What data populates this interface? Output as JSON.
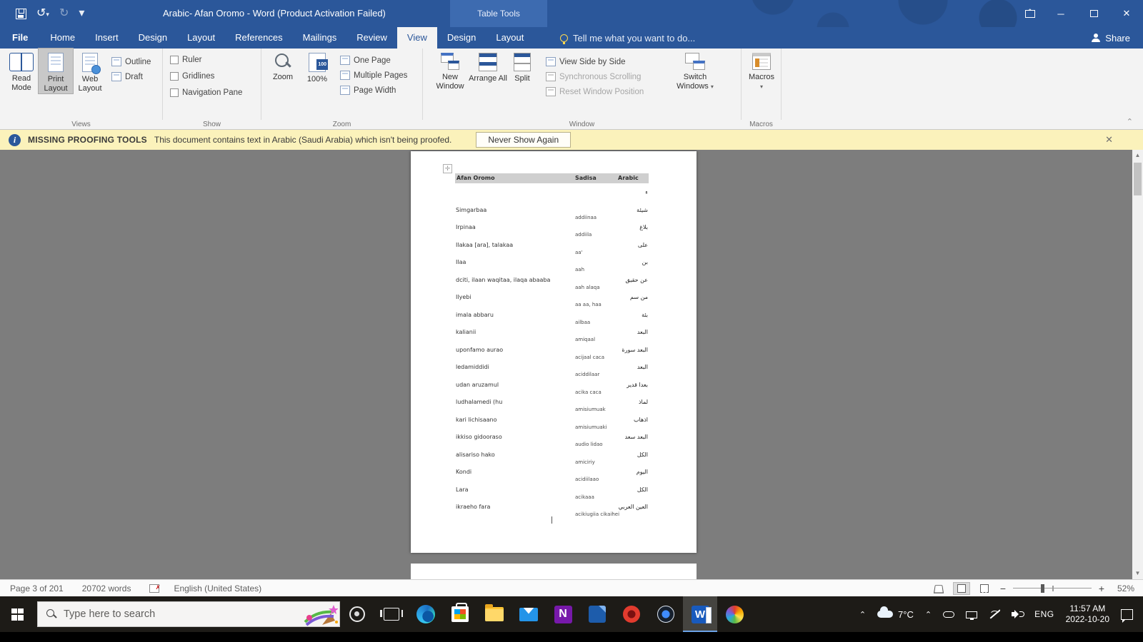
{
  "colors": {
    "accent": "#2b579a",
    "warning_bg": "#fbf2bb",
    "doc_bg": "#7d7d7d",
    "taskbar_bg": "#1d1b17"
  },
  "titlebar": {
    "title": "Arabic- Afan Oromo - Word (Product Activation Failed)",
    "contextual_group": "Table Tools"
  },
  "tabs": [
    {
      "label": "File",
      "type": "file"
    },
    {
      "label": "Home"
    },
    {
      "label": "Insert"
    },
    {
      "label": "Design"
    },
    {
      "label": "Layout"
    },
    {
      "label": "References"
    },
    {
      "label": "Mailings"
    },
    {
      "label": "Review"
    },
    {
      "label": "View",
      "active": true
    },
    {
      "label": "Design"
    },
    {
      "label": "Layout"
    }
  ],
  "tell_me": "Tell me what you want to do...",
  "share_label": "Share",
  "ribbon": {
    "views": {
      "group_label": "Views",
      "read_mode": "Read Mode",
      "print_layout": "Print Layout",
      "web_layout": "Web Layout",
      "outline": "Outline",
      "draft": "Draft"
    },
    "show": {
      "group_label": "Show",
      "ruler": "Ruler",
      "gridlines": "Gridlines",
      "nav_pane": "Navigation Pane"
    },
    "zoom": {
      "group_label": "Zoom",
      "zoom": "Zoom",
      "hundred": "100%",
      "one_page": "One Page",
      "multiple_pages": "Multiple Pages",
      "page_width": "Page Width"
    },
    "window": {
      "group_label": "Window",
      "new_window": "New Window",
      "arrange_all": "Arrange All",
      "split": "Split",
      "side_by_side": "View Side by Side",
      "sync_scrolling": "Synchronous Scrolling",
      "reset_position": "Reset Window Position",
      "switch_windows": "Switch Windows"
    },
    "macros": {
      "group_label": "Macros",
      "macros": "Macros"
    }
  },
  "message_bar": {
    "title": "MISSING PROOFING TOOLS",
    "text": "This document contains text in Arabic (Saudi Arabia) which isn't being proofed.",
    "dismiss": "Never Show Again",
    "close": "✕"
  },
  "document": {
    "table": {
      "headers": [
        "Afan Oromo",
        "Sadisa",
        "Arabic"
      ],
      "rows": [
        {
          "o": "",
          "t": "",
          "a": "ء"
        },
        {
          "o": "Simgarbaa",
          "t": "addiinaa",
          "a": "شيئة"
        },
        {
          "o": "Irpinaa",
          "t": "addiila",
          "a": "بلاغ"
        },
        {
          "o": "Ilakaa [ara], talakaa",
          "t": "aa'",
          "a": "على"
        },
        {
          "o": "Ilaa",
          "t": "aah",
          "a": "بن"
        },
        {
          "o": "dciti, ilaan waqitaa, ilaqa abaaba",
          "t": "aah alaqa",
          "a": "عن حقيق"
        },
        {
          "o": "Ilyebi",
          "t": "aa aa, haa",
          "a": "من سم"
        },
        {
          "o": "imala abbaru",
          "t": "ailbaa",
          "a": "بئة"
        },
        {
          "o": "kalianii",
          "t": "amiqaal",
          "a": "البعد"
        },
        {
          "o": "uponfamo aurao",
          "t": "acijaal caca",
          "a": "البعد سورة"
        },
        {
          "o": "ledamiddidi",
          "t": "aciddilaar",
          "a": "البعد"
        },
        {
          "o": "udan aruzamul",
          "t": "acika caca",
          "a": "بعدا قدير"
        },
        {
          "o": "ludhalamedi (hu",
          "t": "amisiumuak",
          "a": "لماذ"
        },
        {
          "o": "kari lichisaano",
          "t": "amisiumuaki",
          "a": "اذهاب"
        },
        {
          "o": "ikkiso gidooraso",
          "t": "audio lidao",
          "a": "البعد سعد"
        },
        {
          "o": "alisariso hako",
          "t": "amiciriy",
          "a": "الكل"
        },
        {
          "o": "Kondi",
          "t": "acidiilaao",
          "a": "اليوم"
        },
        {
          "o": "Lara",
          "t": "acikaaa",
          "a": "الكل"
        },
        {
          "o": "ikraeho fara",
          "t": "acikiugiia cikaihei",
          "a": "العين العربي"
        }
      ]
    }
  },
  "status_bar": {
    "page": "Page 3 of 201",
    "words": "20702 words",
    "language": "English (United States)",
    "zoom": "52%"
  },
  "taskbar": {
    "search_placeholder": "Type here to search",
    "tray": {
      "temperature": "7°C",
      "language": "ENG",
      "time": "11:57 AM",
      "date": "2022-10-20"
    }
  }
}
